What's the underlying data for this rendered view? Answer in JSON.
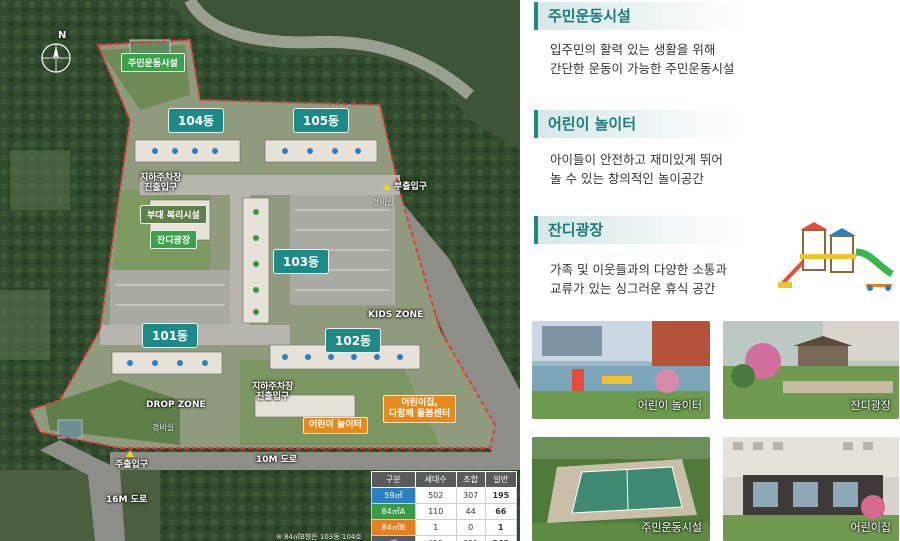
{
  "map": {
    "buildings": {
      "b104": "104동",
      "b105": "105동",
      "b103": "103동",
      "b101": "101동",
      "b102": "102동"
    },
    "facility_tags": {
      "fitness": "주민운동시설",
      "welfare": "부대 복리시설",
      "lawn": "잔디광장",
      "playground": "어린이 놀이터",
      "daycare_line1": "어린이집,",
      "daycare_line2": "다함께 돌봄센터"
    },
    "labels": {
      "parking_north_1": "지하주차장",
      "parking_north_2": "진출입구",
      "sub_gate": "부출입구",
      "guard_east": "경비실",
      "kids_zone": "KIDS ZONE",
      "parking_south_1": "지하주차장",
      "parking_south_2": "진출입구",
      "drop_zone": "DROP ZONE",
      "guard_west": "경비실",
      "main_gate": "주출입구",
      "road_10m": "10M 도로",
      "road_16m": "16M 도로",
      "compass": "N"
    },
    "legend": {
      "headers": [
        "구분",
        "세대수",
        "조합",
        "일반"
      ],
      "rows": [
        {
          "type": "59㎡",
          "units": "502",
          "union": "307",
          "general": "195",
          "color": "#2d7fc1"
        },
        {
          "type": "84㎡A",
          "units": "110",
          "union": "44",
          "general": "66",
          "color": "#3b9a48"
        },
        {
          "type": "84㎡B",
          "units": "1",
          "union": "0",
          "general": "1",
          "color": "#e67e22"
        },
        {
          "type": "계",
          "units": "613",
          "union": "351",
          "general": "262",
          "color": "#5b5b5b"
        }
      ]
    },
    "note": "※ 84㎡B형은 103동 104호"
  },
  "sections": [
    {
      "title": "주민운동시설",
      "line1": "입주민의 활력 있는 생활을 위해",
      "line2": "간단한 운동이 가능한 주민운동시설"
    },
    {
      "title": "어린이 놀이터",
      "line1": "아이들이 안전하고 재미있게 뛰어",
      "line2": "놀 수 있는 창의적인 놀이공간"
    },
    {
      "title": "잔디광장",
      "line1": "가족 및 이웃들과의 다양한 소통과",
      "line2": "교류가 있는 싱그러운 휴식 공간"
    }
  ],
  "photos": {
    "playground": "어린이 놀이터",
    "lawn": "잔디광장",
    "fitness": "주민운동시설",
    "daycare": "어린이집"
  },
  "colors": {
    "accent": "#1c8a86",
    "boundary": "#e8383d",
    "tag_green": "#3aa24a",
    "tag_orange": "#e68a1e"
  }
}
